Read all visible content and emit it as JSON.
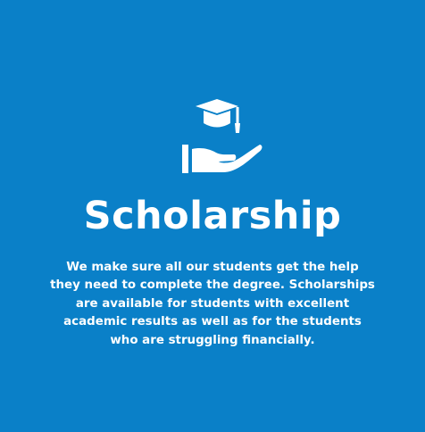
{
  "card": {
    "background_color": "#0a80c8",
    "text_color": "#ffffff",
    "icon": "graduation-cap-in-hand-icon",
    "title": "Scholarship",
    "description": "We make sure all our students get the help they need to complete the degree. Scholarships are available for students with excellent academic results as well as for the students who are struggling financially."
  }
}
